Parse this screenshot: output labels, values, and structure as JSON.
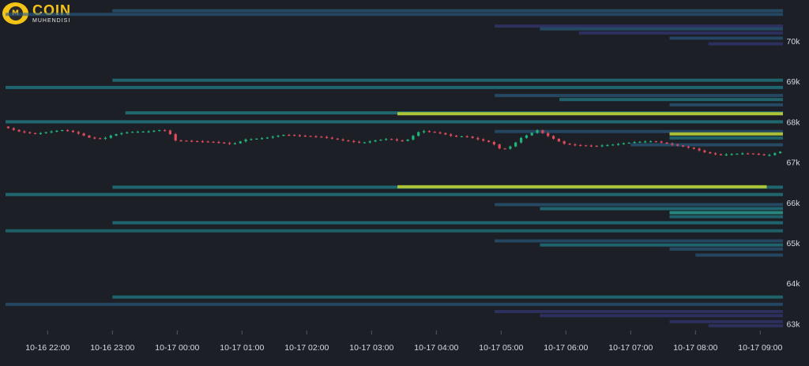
{
  "logo": {
    "name": "COIN",
    "subtitle": "MUHENDISI"
  },
  "colors": {
    "background": "#1c1f25",
    "up": "#1fb57a",
    "down": "#e04a5c",
    "axis_text": "#d7dbe2"
  },
  "chart_data": {
    "type": "candlestick-with-liquidity-heatmap",
    "x_ticks": [
      "10-16 22:00",
      "10-16 23:00",
      "10-17 00:00",
      "10-17 01:00",
      "10-17 02:00",
      "10-17 03:00",
      "10-17 04:00",
      "10-17 05:00",
      "10-17 06:00",
      "10-17 07:00",
      "10-17 08:00",
      "10-17 09:00"
    ],
    "y_ticks": [
      {
        "value": 70000,
        "label": "70k"
      },
      {
        "value": 69000,
        "label": "69k"
      },
      {
        "value": 68000,
        "label": "68k"
      },
      {
        "value": 67000,
        "label": "67k"
      },
      {
        "value": 66000,
        "label": "66k"
      },
      {
        "value": 65000,
        "label": "65k"
      },
      {
        "value": 64000,
        "label": "64k"
      },
      {
        "value": 63000,
        "label": "63k"
      }
    ],
    "ylim": [
      62900,
      70800
    ],
    "x_hours": [
      -0.65,
      11.35
    ],
    "price_path": [
      [
        -0.65,
        67880
      ],
      [
        -0.4,
        67760
      ],
      [
        -0.15,
        67700
      ],
      [
        0.1,
        67760
      ],
      [
        0.3,
        67800
      ],
      [
        0.5,
        67720
      ],
      [
        0.7,
        67600
      ],
      [
        0.9,
        67580
      ],
      [
        1.05,
        67680
      ],
      [
        1.3,
        67750
      ],
      [
        1.6,
        67760
      ],
      [
        1.8,
        67800
      ],
      [
        1.9,
        67770
      ],
      [
        2.0,
        67540
      ],
      [
        2.3,
        67520
      ],
      [
        2.6,
        67500
      ],
      [
        2.9,
        67450
      ],
      [
        3.1,
        67560
      ],
      [
        3.4,
        67600
      ],
      [
        3.7,
        67680
      ],
      [
        4.0,
        67650
      ],
      [
        4.3,
        67620
      ],
      [
        4.6,
        67540
      ],
      [
        4.9,
        67480
      ],
      [
        5.1,
        67540
      ],
      [
        5.3,
        67580
      ],
      [
        5.5,
        67520
      ],
      [
        5.6,
        67560
      ],
      [
        5.8,
        67780
      ],
      [
        6.1,
        67720
      ],
      [
        6.3,
        67640
      ],
      [
        6.5,
        67640
      ],
      [
        6.7,
        67560
      ],
      [
        6.9,
        67480
      ],
      [
        7.05,
        67300
      ],
      [
        7.2,
        67400
      ],
      [
        7.35,
        67600
      ],
      [
        7.6,
        67790
      ],
      [
        7.8,
        67620
      ],
      [
        8.0,
        67460
      ],
      [
        8.2,
        67420
      ],
      [
        8.5,
        67400
      ],
      [
        8.8,
        67440
      ],
      [
        9.1,
        67500
      ],
      [
        9.4,
        67520
      ],
      [
        9.6,
        67460
      ],
      [
        9.8,
        67400
      ],
      [
        10.0,
        67340
      ],
      [
        10.2,
        67240
      ],
      [
        10.4,
        67180
      ],
      [
        10.6,
        67200
      ],
      [
        10.8,
        67220
      ],
      [
        11.0,
        67200
      ],
      [
        11.15,
        67160
      ],
      [
        11.3,
        67240
      ],
      [
        11.35,
        67260
      ]
    ],
    "liquidity_levels": [
      {
        "price": 70750,
        "from": 1.0,
        "to": 11.35,
        "intensity": 0.35
      },
      {
        "price": 70660,
        "from": -0.65,
        "to": 11.35,
        "intensity": 0.3
      },
      {
        "price": 70370,
        "from": 6.9,
        "to": 11.35,
        "intensity": 0.22
      },
      {
        "price": 70300,
        "from": 7.6,
        "to": 11.35,
        "intensity": 0.35
      },
      {
        "price": 70200,
        "from": 8.2,
        "to": 11.35,
        "intensity": 0.25
      },
      {
        "price": 70070,
        "from": 9.6,
        "to": 11.35,
        "intensity": 0.3
      },
      {
        "price": 69930,
        "from": 10.2,
        "to": 11.35,
        "intensity": 0.25
      },
      {
        "price": 69030,
        "from": 1.0,
        "to": 11.35,
        "intensity": 0.45
      },
      {
        "price": 68850,
        "from": -0.65,
        "to": 11.35,
        "intensity": 0.5
      },
      {
        "price": 68650,
        "from": 6.9,
        "to": 11.35,
        "intensity": 0.32
      },
      {
        "price": 68550,
        "from": 7.9,
        "to": 11.35,
        "intensity": 0.45
      },
      {
        "price": 68420,
        "from": 9.6,
        "to": 11.35,
        "intensity": 0.35
      },
      {
        "price": 68220,
        "from": 1.2,
        "to": 11.35,
        "intensity": 0.55
      },
      {
        "price": 68200,
        "from": 5.4,
        "to": 11.35,
        "intensity": 0.95
      },
      {
        "price": 68000,
        "from": -0.65,
        "to": 11.35,
        "intensity": 0.55
      },
      {
        "price": 67760,
        "from": 6.9,
        "to": 11.35,
        "intensity": 0.3
      },
      {
        "price": 67700,
        "from": 9.6,
        "to": 11.35,
        "intensity": 0.9
      },
      {
        "price": 67600,
        "from": 9.6,
        "to": 11.35,
        "intensity": 0.4
      },
      {
        "price": 67430,
        "from": 9.0,
        "to": 11.35,
        "intensity": 0.35
      },
      {
        "price": 66380,
        "from": 1.0,
        "to": 11.35,
        "intensity": 0.5
      },
      {
        "price": 66390,
        "from": 5.4,
        "to": 11.1,
        "intensity": 0.95
      },
      {
        "price": 66200,
        "from": -0.65,
        "to": 11.35,
        "intensity": 0.55
      },
      {
        "price": 65950,
        "from": 6.9,
        "to": 11.35,
        "intensity": 0.35
      },
      {
        "price": 65850,
        "from": 7.6,
        "to": 11.35,
        "intensity": 0.5
      },
      {
        "price": 65750,
        "from": 9.6,
        "to": 11.35,
        "intensity": 0.75
      },
      {
        "price": 65650,
        "from": 9.6,
        "to": 11.35,
        "intensity": 0.4
      },
      {
        "price": 65500,
        "from": 1.0,
        "to": 11.35,
        "intensity": 0.5
      },
      {
        "price": 65300,
        "from": -0.65,
        "to": 11.35,
        "intensity": 0.4
      },
      {
        "price": 65050,
        "from": 6.9,
        "to": 11.35,
        "intensity": 0.3
      },
      {
        "price": 64950,
        "from": 7.6,
        "to": 11.35,
        "intensity": 0.45
      },
      {
        "price": 64850,
        "from": 9.6,
        "to": 11.35,
        "intensity": 0.35
      },
      {
        "price": 64700,
        "from": 10.0,
        "to": 11.35,
        "intensity": 0.3
      },
      {
        "price": 63660,
        "from": 1.0,
        "to": 11.35,
        "intensity": 0.45
      },
      {
        "price": 63480,
        "from": -0.65,
        "to": 11.35,
        "intensity": 0.3
      },
      {
        "price": 63300,
        "from": 6.9,
        "to": 11.35,
        "intensity": 0.22
      },
      {
        "price": 63200,
        "from": 7.6,
        "to": 11.35,
        "intensity": 0.25
      },
      {
        "price": 63050,
        "from": 9.6,
        "to": 11.35,
        "intensity": 0.22
      },
      {
        "price": 62950,
        "from": 10.2,
        "to": 11.35,
        "intensity": 0.2
      }
    ]
  }
}
